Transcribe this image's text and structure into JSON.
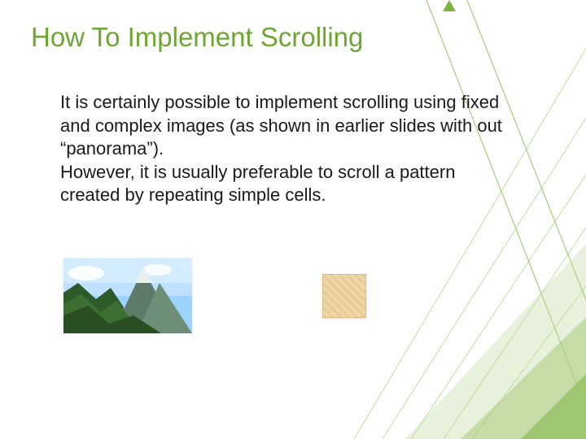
{
  "title": "How To Implement Scrolling",
  "body": {
    "p1": "It is certainly possible to implement scrolling using fixed and complex images (as shown in earlier slides with out “panorama”).",
    "p2": "However, it is usually preferable to scroll a pattern created by repeating simple cells."
  },
  "images": {
    "mountain_alt": "mountain landscape complex image",
    "tile_alt": "simple repeating tile cell"
  },
  "theme": {
    "accent": "#6fa532"
  }
}
